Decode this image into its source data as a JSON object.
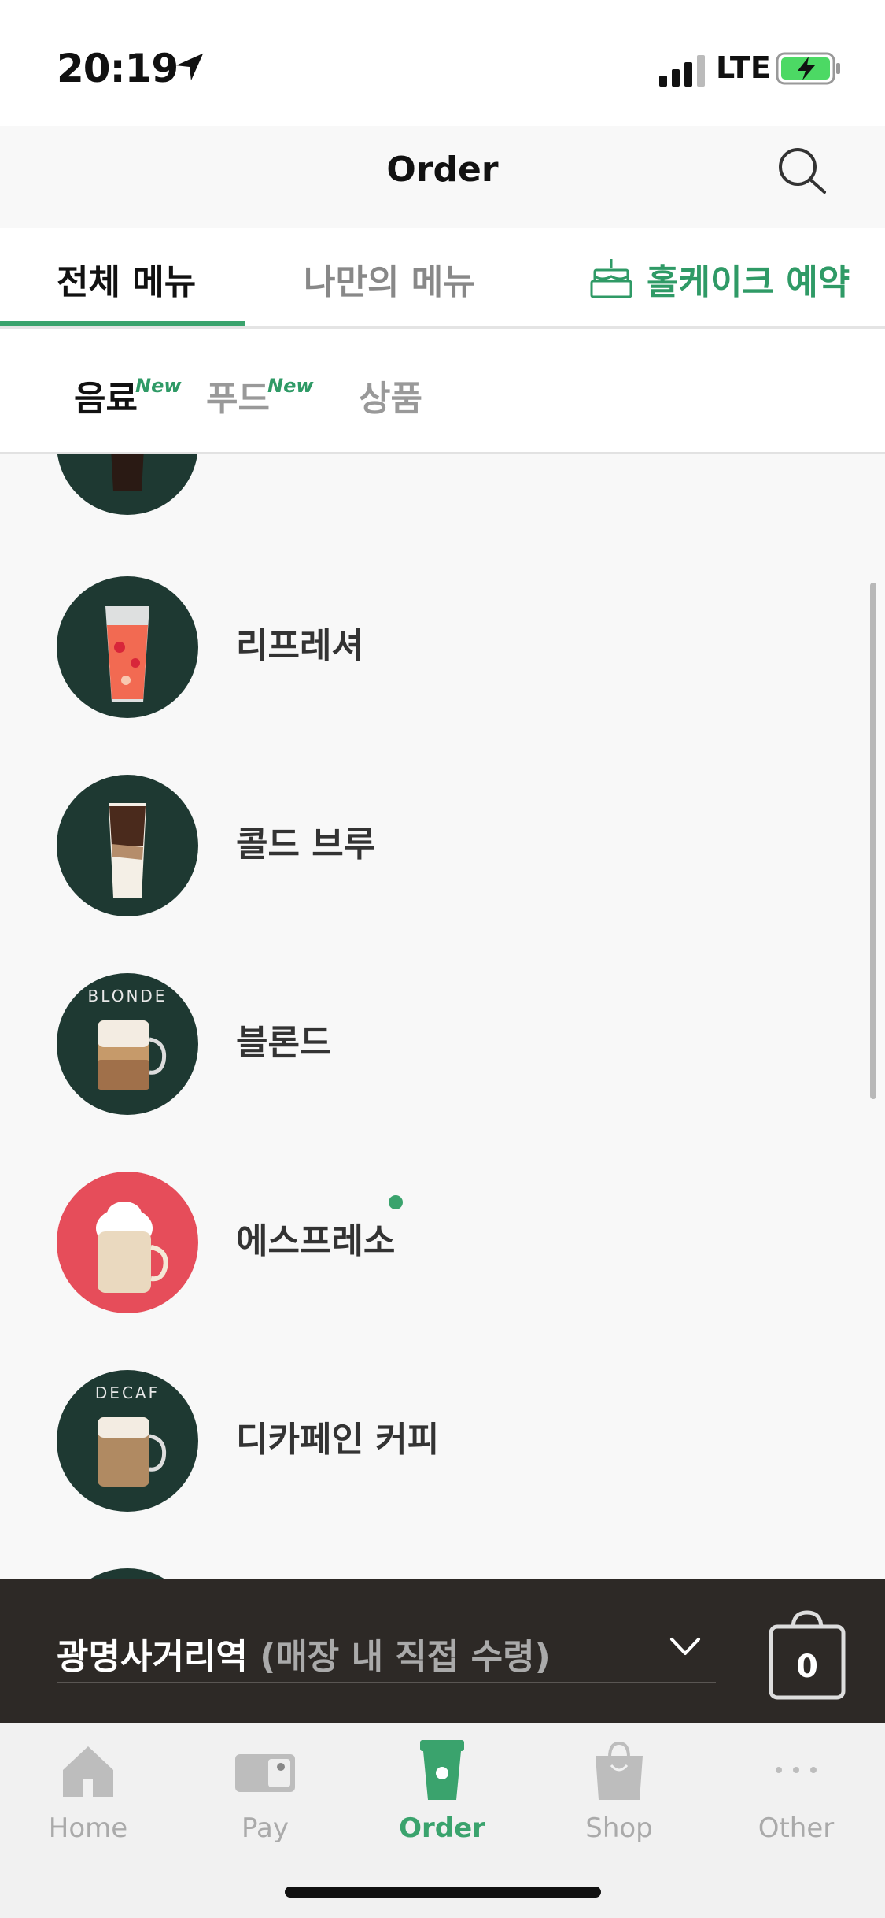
{
  "status_bar": {
    "time": "20:19",
    "network": "LTE"
  },
  "header": {
    "title": "Order"
  },
  "tabs": [
    {
      "label": "전체 메뉴",
      "active": true
    },
    {
      "label": "나만의 메뉴",
      "active": false
    },
    {
      "label": "홀케이크 예약",
      "active": false
    }
  ],
  "sub_tabs": [
    {
      "label": "음료",
      "badge": "New",
      "active": true
    },
    {
      "label": "푸드",
      "badge": "New",
      "active": false
    },
    {
      "label": "상품",
      "badge": "",
      "active": false
    }
  ],
  "menu_items": [
    {
      "label": "리프레셔",
      "new_dot": false
    },
    {
      "label": "콜드 브루",
      "new_dot": false
    },
    {
      "label": "블론드",
      "badge_text": "BLONDE",
      "new_dot": false
    },
    {
      "label": "에스프레소",
      "new_dot": true
    },
    {
      "label": "디카페인 커피",
      "badge_text": "DECAF",
      "new_dot": false
    }
  ],
  "store": {
    "name": "광명사거리역",
    "pickup": "(매장 내 직접 수령)",
    "cart_count": "0"
  },
  "bottom_nav": [
    {
      "label": "Home",
      "icon": "home-icon",
      "active": false
    },
    {
      "label": "Pay",
      "icon": "card-icon",
      "active": false
    },
    {
      "label": "Order",
      "icon": "cup-icon",
      "active": true
    },
    {
      "label": "Shop",
      "icon": "shopping-bag-icon",
      "active": false
    },
    {
      "label": "Other",
      "icon": "more-dots-icon",
      "active": false
    }
  ],
  "colors": {
    "accent": "#3aa36d",
    "dark_green": "#1e3932",
    "store_bar": "#2d2926",
    "red_circle": "#e64d5a"
  }
}
